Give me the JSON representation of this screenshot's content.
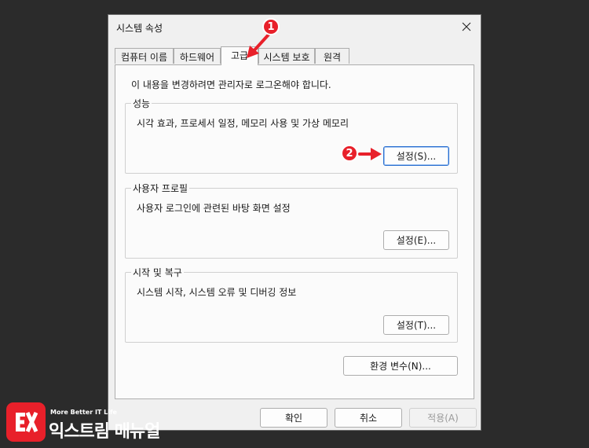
{
  "window": {
    "title": "시스템 속성"
  },
  "tabs": [
    {
      "label": "컴퓨터 이름"
    },
    {
      "label": "하드웨어"
    },
    {
      "label": "고급",
      "active": true
    },
    {
      "label": "시스템 보호"
    },
    {
      "label": "원격"
    }
  ],
  "intro_text": "이 내용을 변경하려면 관리자로 로그온해야 합니다.",
  "groups": {
    "performance": {
      "label": "성능",
      "description": "시각 효과, 프로세서 일정, 메모리 사용 및 가상 메모리",
      "button": "설정(S)..."
    },
    "user_profile": {
      "label": "사용자 프로필",
      "description": "사용자 로그인에 관련된 바탕 화면 설정",
      "button": "설정(E)..."
    },
    "startup": {
      "label": "시작 및 복구",
      "description": "시스템 시작, 시스템 오류 및 디버깅 정보",
      "button": "설정(T)..."
    }
  },
  "env_button": "환경 변수(N)...",
  "footer": {
    "ok": "확인",
    "cancel": "취소",
    "apply": "적용(A)"
  },
  "annotations": {
    "step1": "1",
    "step2": "2",
    "color": "#e8202a"
  },
  "logo": {
    "small_text": "More Better IT Life",
    "big_text": "익스트림 매뉴얼"
  },
  "icons": {
    "close": "close-icon",
    "arrow": "arrow-icon",
    "logo": "logo-mark-icon"
  }
}
